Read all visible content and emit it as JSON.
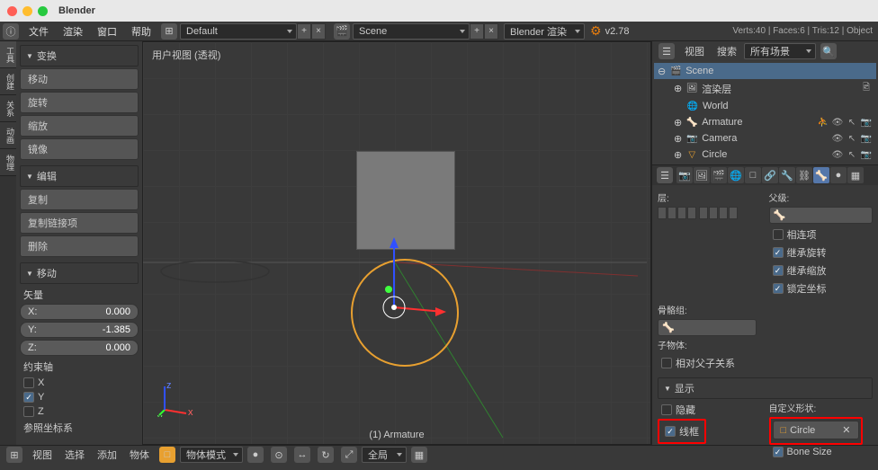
{
  "app_title": "Blender",
  "menubar": {
    "file": "文件",
    "render": "渲染",
    "window": "窗口",
    "help": "帮助"
  },
  "header": {
    "layout_dropdown": "Default",
    "scene_dropdown": "Scene",
    "engine_dropdown": "Blender 渲染",
    "version": "v2.78",
    "stats": "Verts:40 | Faces:6 | Tris:12 | Object"
  },
  "left_tabs": [
    "工具",
    "创建",
    "关系",
    "动画",
    "物理"
  ],
  "tool_panel": {
    "transform_header": "变换",
    "move": "移动",
    "rotate": "旋转",
    "scale": "缩放",
    "mirror": "镜像",
    "edit_header": "编辑",
    "duplicate": "复制",
    "duplicate_linked": "复制链接项",
    "delete": "删除",
    "translate_header": "移动",
    "vector_label": "矢量",
    "x_label": "X:",
    "x_val": "0.000",
    "y_label": "Y:",
    "y_val": "-1.385",
    "z_label": "Z:",
    "z_val": "0.000",
    "constraint_label": "约束轴",
    "cx": "X",
    "cy": "Y",
    "cz": "Z",
    "ref_label": "参照坐标系"
  },
  "viewport": {
    "label": "用户视图 (透视)",
    "object": "(1) Armature"
  },
  "bottom_bar": {
    "view": "视图",
    "select": "选择",
    "add": "添加",
    "object": "物体",
    "mode": "物体模式",
    "global": "全局"
  },
  "outliner": {
    "view_btn": "视图",
    "search_btn": "搜索",
    "filter": "所有场景",
    "items": [
      {
        "name": "Scene",
        "icon": "🎬",
        "indent": 0,
        "selected": true
      },
      {
        "name": "渲染层",
        "icon": "🖼",
        "indent": 1
      },
      {
        "name": "World",
        "icon": "🌐",
        "indent": 1
      },
      {
        "name": "Armature",
        "icon": "🦴",
        "indent": 1,
        "actions": true
      },
      {
        "name": "Camera",
        "icon": "📷",
        "indent": 1,
        "actions": true
      },
      {
        "name": "Circle",
        "icon": "▽",
        "indent": 1,
        "actions": true
      }
    ]
  },
  "props": {
    "layer_label": "层:",
    "parent_label": "父级:",
    "related": "相连项",
    "inherit_rot": "继承旋转",
    "inherit_scale": "继承缩放",
    "lock_loc": "锁定坐标",
    "bone_group": "骨骼组:",
    "sub_object": "子物体:",
    "rel_parent": "相对父子关系",
    "display_header": "显示",
    "hide": "隐藏",
    "wireframe": "线框",
    "custom_shape": "自定义形状:",
    "shape_value": "Circle",
    "bone_size": "Bone Size"
  }
}
